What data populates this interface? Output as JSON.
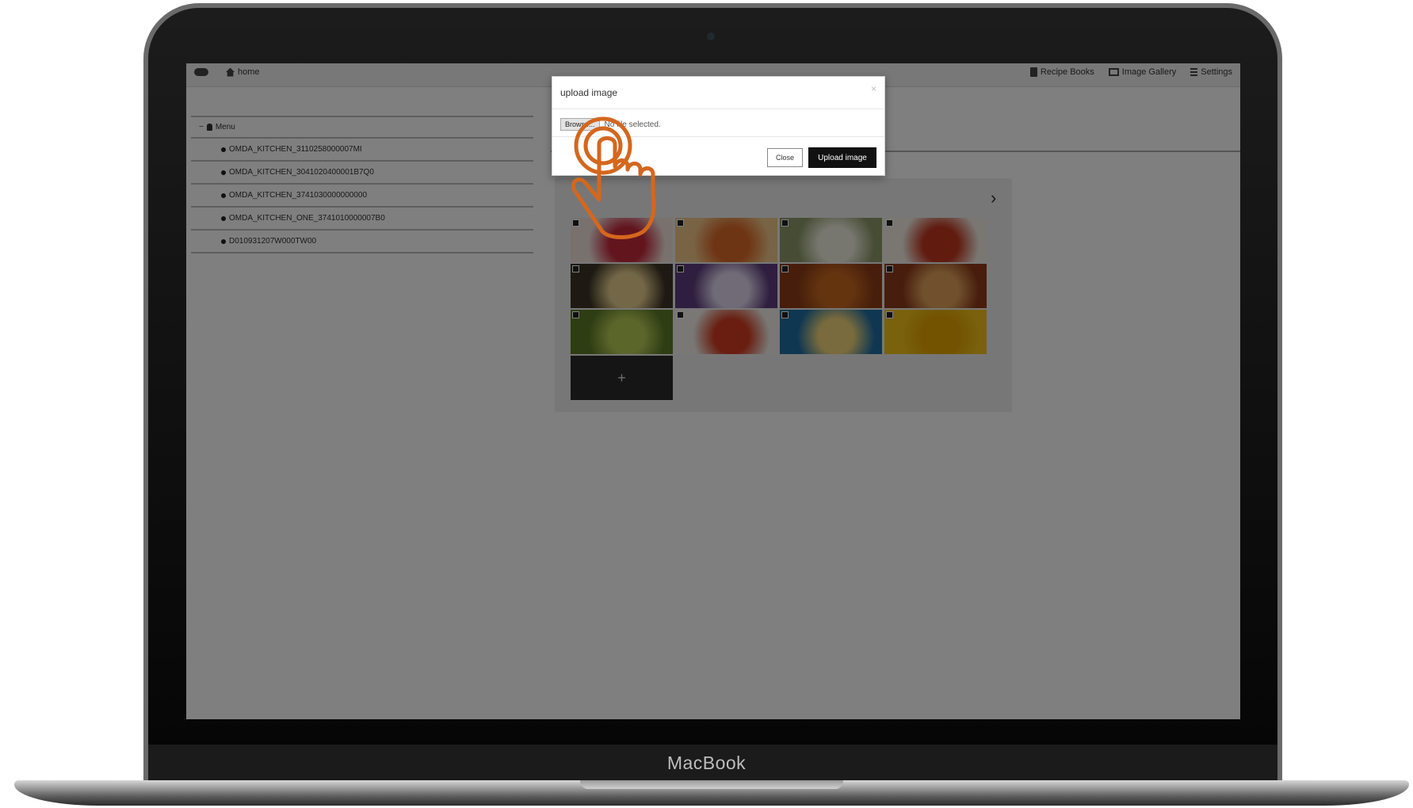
{
  "device": {
    "brand": "MacBook"
  },
  "topnav": {
    "home_label": "home",
    "right_items": [
      {
        "label": "Recipe Books",
        "icon": "book-icon"
      },
      {
        "label": "Image Gallery",
        "icon": "image-icon"
      },
      {
        "label": "Settings",
        "icon": "list-icon"
      }
    ]
  },
  "tree": {
    "root_label": "Menu",
    "items": [
      "OMDA_KITCHEN_3110258000007MI",
      "OMDA_KITCHEN_3041020400001B7Q0",
      "OMDA_KITCHEN_3741030000000000",
      "OMDA_KITCHEN_ONE_3741010000007B0",
      "D010931207W000TW00"
    ]
  },
  "gallery": {
    "next_glyph": "›",
    "add_glyph": "+",
    "thumb_colors": [
      [
        "#f3e2dd",
        "#c72a3d"
      ],
      [
        "#f1c98a",
        "#dd6a2a"
      ],
      [
        "#8f9a6a",
        "#efefe0"
      ],
      [
        "#f4eee6",
        "#c2361e"
      ],
      [
        "#3d3526",
        "#e7cf8e"
      ],
      [
        "#5e3d7e",
        "#e2d7ee"
      ],
      [
        "#8e3d17",
        "#c8681f"
      ],
      [
        "#8e3a1a",
        "#e2a35a"
      ],
      [
        "#5c7a27",
        "#b7cc57"
      ],
      [
        "#f2f0ea",
        "#d43d22"
      ],
      [
        "#1f6fa3",
        "#f3d77a"
      ],
      [
        "#f2c21c",
        "#e6a400"
      ]
    ]
  },
  "modal": {
    "title": "upload image",
    "close_x": "×",
    "choose_label": "Browse...",
    "file_status": "No file selected.",
    "close_button": "Close",
    "upload_button": "Upload image"
  },
  "colors": {
    "pointer_accent": "#d4671e",
    "overlay": "rgba(0,0,0,0.5)"
  }
}
